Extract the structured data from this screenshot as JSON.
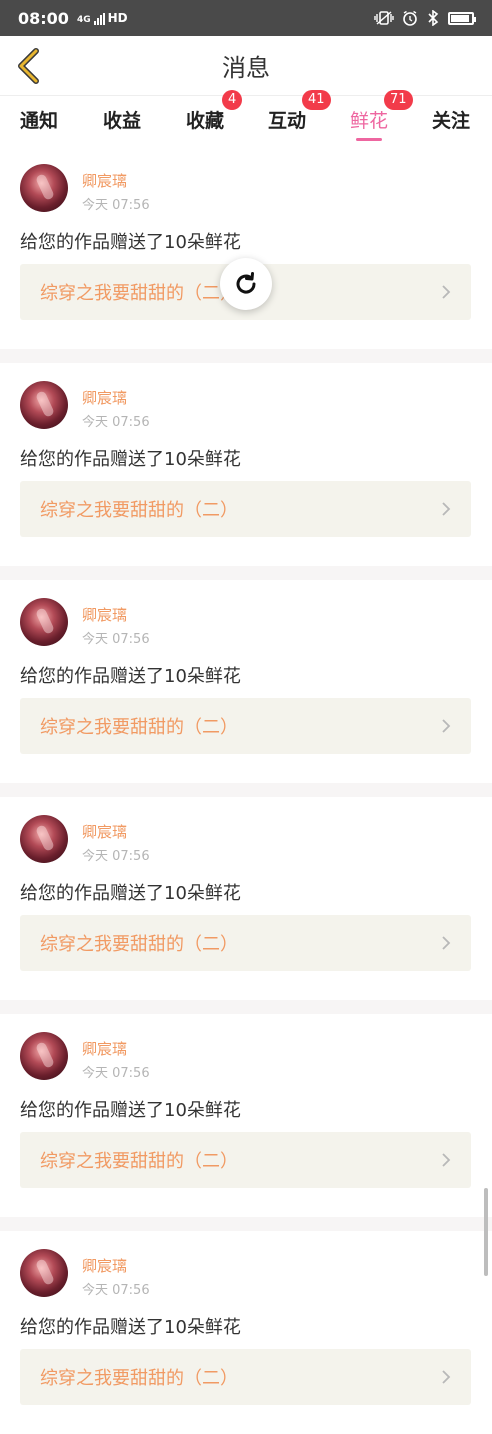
{
  "status_bar": {
    "time": "08:00",
    "network": "4G",
    "hd": "HD",
    "icons": [
      "vibrate-icon",
      "alarm-icon",
      "bluetooth-icon",
      "battery-icon"
    ],
    "battery_level": 0.9
  },
  "header": {
    "title": "消息",
    "back_icon": "chevron-left-icon"
  },
  "tabs": [
    {
      "label": "通知",
      "badge": ""
    },
    {
      "label": "收益",
      "badge": ""
    },
    {
      "label": "收藏",
      "badge": "4"
    },
    {
      "label": "互动",
      "badge": "41"
    },
    {
      "label": "鲜花",
      "badge": "71",
      "active": true
    },
    {
      "label": "关注",
      "badge": ""
    }
  ],
  "messages": [
    {
      "user": "卿宸璃",
      "time": "今天 07:56",
      "text": "给您的作品赠送了10朵鲜花",
      "book": "综穿之我要甜甜的（二）"
    },
    {
      "user": "卿宸璃",
      "time": "今天 07:56",
      "text": "给您的作品赠送了10朵鲜花",
      "book": "综穿之我要甜甜的（二）"
    },
    {
      "user": "卿宸璃",
      "time": "今天 07:56",
      "text": "给您的作品赠送了10朵鲜花",
      "book": "综穿之我要甜甜的（二）"
    },
    {
      "user": "卿宸璃",
      "time": "今天 07:56",
      "text": "给您的作品赠送了10朵鲜花",
      "book": "综穿之我要甜甜的（二）"
    },
    {
      "user": "卿宸璃",
      "time": "今天 07:56",
      "text": "给您的作品赠送了10朵鲜花",
      "book": "综穿之我要甜甜的（二）"
    },
    {
      "user": "卿宸璃",
      "time": "今天 07:56",
      "text": "给您的作品赠送了10朵鲜花",
      "book": "综穿之我要甜甜的（二）"
    }
  ],
  "colors": {
    "accent": "#ee66a0",
    "badge": "#f23b4a",
    "username": "#f19a63",
    "back_arrow": "#e8b630",
    "link_bg": "#f4f3ec"
  }
}
